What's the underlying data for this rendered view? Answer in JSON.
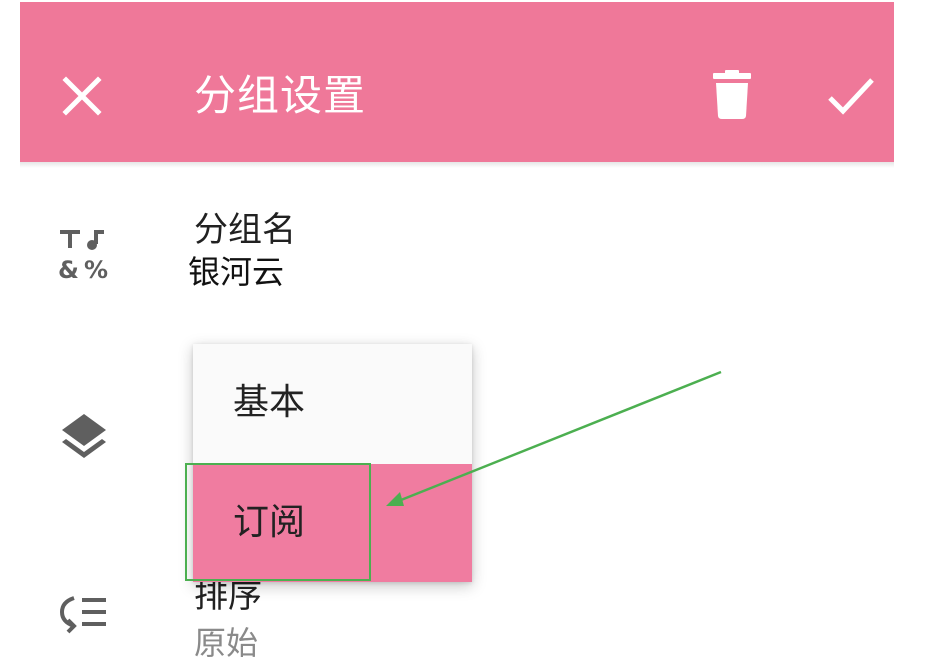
{
  "header": {
    "title": "分组设置",
    "close_icon": "close-icon",
    "delete_icon": "trash-icon",
    "confirm_icon": "check-icon"
  },
  "group_name": {
    "icon": "text-symbols-icon",
    "label": "分组名",
    "value": "银河云"
  },
  "group_type": {
    "icon": "layers-icon",
    "options": [
      "基本",
      "订阅"
    ],
    "selected": "订阅"
  },
  "sort": {
    "icon": "sort-list-icon",
    "label": "排序",
    "value": "原始"
  },
  "colors": {
    "primary": "#ef7899",
    "selected_option": "#f07ca0",
    "annotation": "#4caf50",
    "icon_gray": "#5f5f5f"
  }
}
